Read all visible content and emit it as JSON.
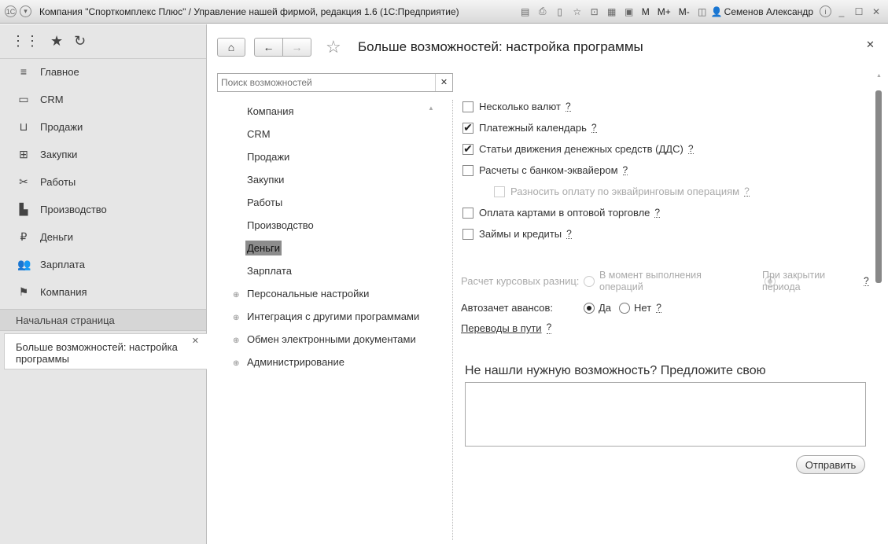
{
  "window": {
    "title": "Компания \"Спорткомплекс Плюс\" / Управление нашей фирмой, редакция 1.6  (1С:Предприятие)",
    "user": "Семенов Александр",
    "m": "M",
    "mplus": "M+",
    "mminus": "M-"
  },
  "sidebar": {
    "items": [
      {
        "label": "Главное",
        "icon": "menu-icon"
      },
      {
        "label": "CRM",
        "icon": "crm-icon"
      },
      {
        "label": "Продажи",
        "icon": "basket-icon"
      },
      {
        "label": "Закупки",
        "icon": "cart-icon"
      },
      {
        "label": "Работы",
        "icon": "tools-icon"
      },
      {
        "label": "Производство",
        "icon": "factory-icon"
      },
      {
        "label": "Деньги",
        "icon": "ruble-icon"
      },
      {
        "label": "Зарплата",
        "icon": "people-icon"
      },
      {
        "label": "Компания",
        "icon": "flag-icon"
      }
    ],
    "home_page": "Начальная страница",
    "open_item": "Больше возможностей: настройка программы"
  },
  "page": {
    "title": "Больше возможностей: настройка программы",
    "search_placeholder": "Поиск возможностей"
  },
  "tree": {
    "items": [
      "Компания",
      "CRM",
      "Продажи",
      "Закупки",
      "Работы",
      "Производство",
      "Деньги",
      "Зарплата"
    ],
    "selected": "Деньги",
    "groups": [
      "Персональные настройки",
      "Интеграция с другими программами",
      "Обмен электронными документами",
      "Администрирование"
    ]
  },
  "settings": {
    "checkboxes": [
      {
        "label": "Несколько валют",
        "checked": false
      },
      {
        "label": "Платежный календарь",
        "checked": true
      },
      {
        "label": "Статьи движения денежных средств (ДДС)",
        "checked": true
      },
      {
        "label": "Расчеты с банком-эквайером",
        "checked": false
      },
      {
        "label": "Разносить оплату по эквайринговым операциям",
        "checked": false,
        "disabled": true
      },
      {
        "label": "Оплата картами в оптовой торговле",
        "checked": false
      },
      {
        "label": "Займы и кредиты",
        "checked": false
      }
    ],
    "q": "?",
    "rate_label": "Расчет курсовых разниц:",
    "rate_opt1": "В момент выполнения операций",
    "rate_opt2": "При закрытии периода",
    "advance_label": "Автозачет авансов:",
    "yes": "Да",
    "no": "Нет",
    "transfers_link": "Переводы в пути",
    "suggest_title": "Не нашли нужную возможность? Предложите свою",
    "send": "Отправить"
  }
}
